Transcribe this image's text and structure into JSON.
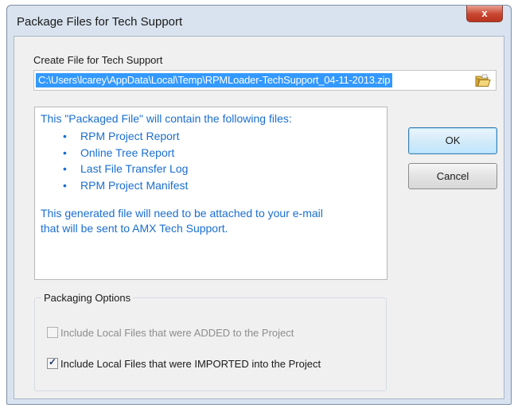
{
  "window": {
    "title": "Package Files for Tech Support",
    "close_glyph": "x"
  },
  "create_file": {
    "label": "Create File for Tech Support",
    "path": "C:\\Users\\lcarey\\AppData\\Local\\Temp\\RPMLoader-TechSupport_04-11-2013.zip",
    "browse_icon": "folder-open-icon"
  },
  "info": {
    "intro": "This \"Packaged File\" will contain the following files:",
    "bullet_glyph": "•",
    "items": [
      "RPM Project Report",
      "Online Tree Report",
      "Last File Transfer Log",
      "RPM Project Manifest"
    ],
    "outro_line1": "This generated file will need to be attached to your e-mail",
    "outro_line2": "that will be sent to AMX Tech Support."
  },
  "buttons": {
    "ok": "OK",
    "cancel": "Cancel"
  },
  "packaging": {
    "group_label": "Packaging Options",
    "options": [
      {
        "label": "Include Local Files that were ADDED to the Project",
        "checked": false,
        "enabled": false
      },
      {
        "label": "Include Local Files that were IMPORTED into the Project",
        "checked": true,
        "enabled": true
      }
    ]
  },
  "colors": {
    "info_text": "#1a6ecf",
    "selection": "#3399ff",
    "close_button": "#c8452f"
  }
}
